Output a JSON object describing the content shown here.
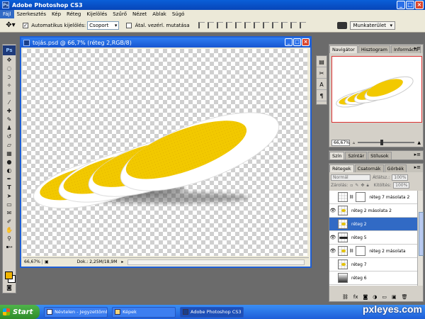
{
  "app": {
    "title": "Adobe Photoshop CS3"
  },
  "menu": [
    "Fájl",
    "Szerkesztés",
    "Kép",
    "Réteg",
    "Kijelölés",
    "Szűrő",
    "Nézet",
    "Ablak",
    "Súgó"
  ],
  "options": {
    "auto_select_label": "Automatikus kijelölés:",
    "auto_select_value": "Csoport",
    "transform_label": "Átal. vezérl. mutatása",
    "workspace_label": "Munkaterület"
  },
  "document": {
    "title": "tojás.psd @ 66,7% (réteg 2,RGB/8)",
    "zoom": "66,67%",
    "doc_info": "Dok.: 2,25M/18,9M"
  },
  "navigator": {
    "tabs": [
      "Navigátor",
      "Hisztogram",
      "Információ"
    ],
    "zoom": "66,67%"
  },
  "color_panel": {
    "tabs": [
      "Szín",
      "Színtár",
      "Stílusok"
    ]
  },
  "layers_panel": {
    "tabs": [
      "Rétegek",
      "Csatornák",
      "Görbék"
    ],
    "blend_mode": "Normál",
    "opacity_label": "Átlátsz.:",
    "opacity_value": "100%",
    "lock_label": "Zárolás:",
    "fill_label": "Kitöltés:",
    "fill_value": "100%",
    "layers": [
      {
        "name": "réteg 7 másolata 2",
        "visible": false,
        "thumb": "blank",
        "mask": true,
        "selected": false
      },
      {
        "name": "réteg 2 másolata 2",
        "visible": true,
        "thumb": "yolk",
        "mask": false,
        "selected": false
      },
      {
        "name": "réteg 2",
        "visible": false,
        "thumb": "yolk",
        "mask": false,
        "selected": true
      },
      {
        "name": "réteg 5",
        "visible": true,
        "thumb": "bar",
        "mask": false,
        "selected": false
      },
      {
        "name": "réteg 2 másolata",
        "visible": true,
        "thumb": "yolk",
        "mask": true,
        "selected": false
      },
      {
        "name": "réteg 7",
        "visible": false,
        "thumb": "yolk",
        "mask": false,
        "selected": false
      },
      {
        "name": "réteg 6",
        "visible": false,
        "thumb": "grad",
        "mask": false,
        "selected": false
      }
    ]
  },
  "taskbar": {
    "start": "Start",
    "tasks": [
      {
        "label": "Névtelen - Jegyzettömb",
        "icon": "notepad-icon",
        "active": false
      },
      {
        "label": "Képek",
        "icon": "folder-icon",
        "active": false
      },
      {
        "label": "Adobe Photoshop CS3",
        "icon": "photoshop-icon",
        "active": true
      }
    ]
  },
  "watermark": "pxleyes.com",
  "colors": {
    "yolk": "#f2c900",
    "egg_white": "#ffffff",
    "accent": "#316ac5",
    "foreground_swatch": "#f0b400"
  }
}
